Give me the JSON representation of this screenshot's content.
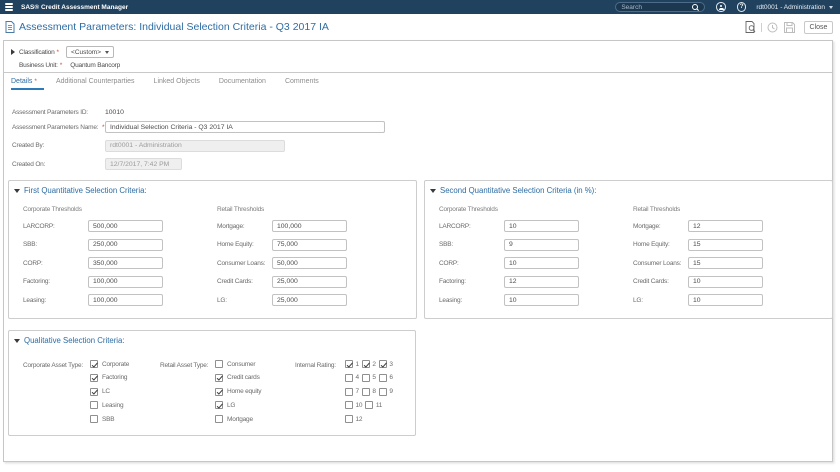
{
  "required_marker": "*",
  "topbar": {
    "app_title": "SAS® Credit Assessment Manager",
    "search_placeholder": "Search",
    "user": "rdt0001 - Administration"
  },
  "header": {
    "title": "Assessment Parameters: Individual Selection Criteria - Q3 2017 IA",
    "close_label": "Close"
  },
  "classification": {
    "label": "Classification",
    "value": "<Custom>",
    "business_unit_label": "Business Unit:",
    "business_unit_value": "Quantum Bancorp"
  },
  "tabs": [
    {
      "label": "Details"
    },
    {
      "label": "Additional Counterparties"
    },
    {
      "label": "Linked Objects"
    },
    {
      "label": "Documentation"
    },
    {
      "label": "Comments"
    }
  ],
  "form": {
    "id_label": "Assessment Parameters ID:",
    "id_value": "10010",
    "name_label": "Assessment Parameters Name:",
    "name_value": "Individual Selection Criteria - Q3 2017 IA",
    "created_by_label": "Created By:",
    "created_by_value": "rdt0001 - Administration",
    "created_on_label": "Created On:",
    "created_on_value": "12/7/2017, 7:42 PM"
  },
  "first_quant": {
    "title": "First Quantitative Selection Criteria:",
    "corporate_header": "Corporate Thresholds",
    "retail_header": "Retail Thresholds",
    "corporate": [
      {
        "label": "LARCORP:",
        "value": "500,000"
      },
      {
        "label": "SBB:",
        "value": "250,000"
      },
      {
        "label": "CORP:",
        "value": "350,000"
      },
      {
        "label": "Factoring:",
        "value": "100,000"
      },
      {
        "label": "Leasing:",
        "value": "100,000"
      }
    ],
    "retail": [
      {
        "label": "Mortgage:",
        "value": "100,000"
      },
      {
        "label": "Home Equity:",
        "value": "75,000"
      },
      {
        "label": "Consumer Loans:",
        "value": "50,000"
      },
      {
        "label": "Credit Cards:",
        "value": "25,000"
      },
      {
        "label": "LG:",
        "value": "25,000"
      }
    ]
  },
  "second_quant": {
    "title": "Second Quantitative Selection Criteria (in %):",
    "corporate_header": "Corporate Thresholds",
    "retail_header": "Retail Thresholds",
    "corporate": [
      {
        "label": "LARCORP:",
        "value": "10"
      },
      {
        "label": "SBB:",
        "value": "9"
      },
      {
        "label": "CORP:",
        "value": "10"
      },
      {
        "label": "Factoring:",
        "value": "12"
      },
      {
        "label": "Leasing:",
        "value": "10"
      }
    ],
    "retail": [
      {
        "label": "Mortgage:",
        "value": "12"
      },
      {
        "label": "Home Equity:",
        "value": "15"
      },
      {
        "label": "Consumer Loans:",
        "value": "15"
      },
      {
        "label": "Credit Cards:",
        "value": "10"
      },
      {
        "label": "LG:",
        "value": "10"
      }
    ]
  },
  "qualitative": {
    "title": "Qualitative Selection Criteria:",
    "corporate_label": "Corporate Asset Type:",
    "corporate_items": [
      {
        "label": "Corporate",
        "checked": true
      },
      {
        "label": "Factoring",
        "checked": true
      },
      {
        "label": "LC",
        "checked": true
      },
      {
        "label": "Leasing",
        "checked": false
      },
      {
        "label": "SBB",
        "checked": false
      }
    ],
    "retail_label": "Retail Asset Type:",
    "retail_items": [
      {
        "label": "Consumer",
        "checked": false
      },
      {
        "label": "Credit cards",
        "checked": true
      },
      {
        "label": "Home equity",
        "checked": true
      },
      {
        "label": "LG",
        "checked": true
      },
      {
        "label": "Mortgage",
        "checked": false
      }
    ],
    "rating_label": "Internal Rating:",
    "rating_rows": [
      [
        {
          "label": "1",
          "checked": true
        },
        {
          "label": "2",
          "checked": true
        },
        {
          "label": "3",
          "checked": true
        }
      ],
      [
        {
          "label": "4",
          "checked": false
        },
        {
          "label": "5",
          "checked": false
        },
        {
          "label": "6",
          "checked": false
        }
      ],
      [
        {
          "label": "7",
          "checked": false
        },
        {
          "label": "8",
          "checked": false
        },
        {
          "label": "9",
          "checked": false
        }
      ],
      [
        {
          "label": "10",
          "checked": false
        },
        {
          "label": "11",
          "checked": false
        }
      ],
      [
        {
          "label": "12",
          "checked": false
        }
      ]
    ]
  }
}
